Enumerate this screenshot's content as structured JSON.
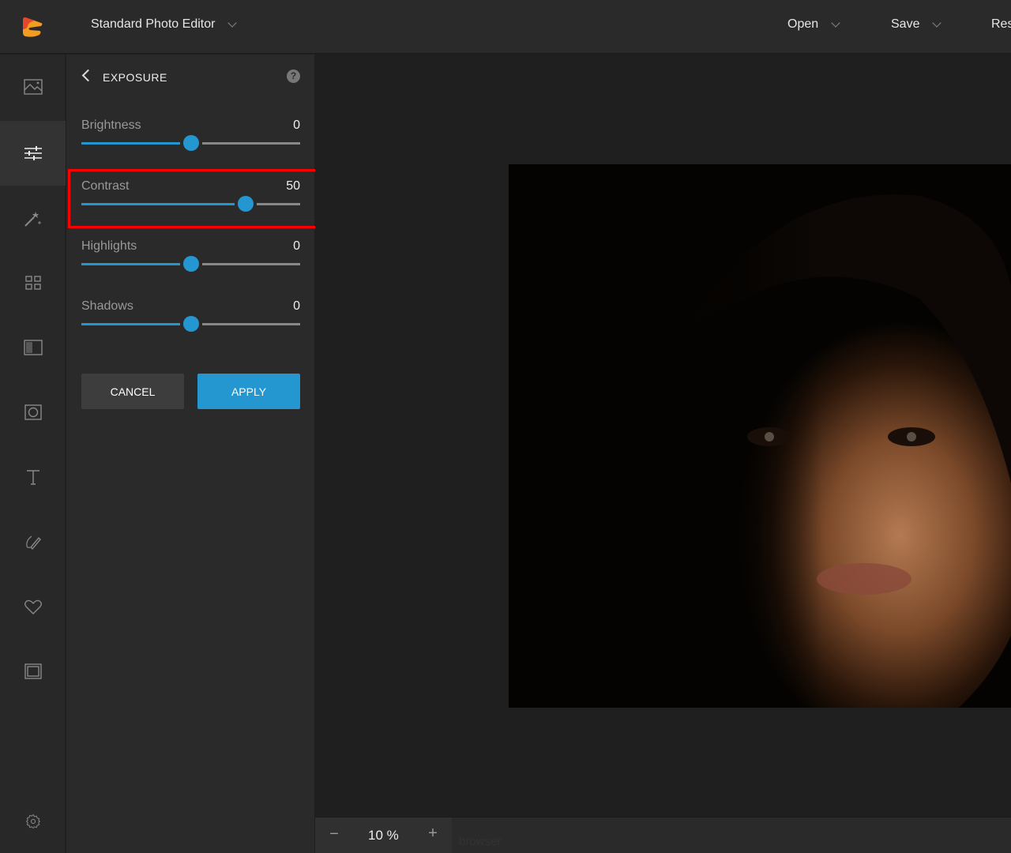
{
  "topbar": {
    "app_title": "Standard Photo Editor",
    "menus": [
      {
        "label": "Open"
      },
      {
        "label": "Save"
      },
      {
        "label": "Res"
      }
    ]
  },
  "rail": {
    "items": [
      {
        "icon": "image-icon",
        "label": "Image"
      },
      {
        "icon": "adjustments-icon",
        "label": "Adjustments",
        "active": true
      },
      {
        "icon": "magic-wand-icon",
        "label": "Effects"
      },
      {
        "icon": "grid-icon",
        "label": "Collage"
      },
      {
        "icon": "texture-icon",
        "label": "Textures"
      },
      {
        "icon": "vignette-icon",
        "label": "Overlays"
      },
      {
        "icon": "text-icon",
        "label": "Text"
      },
      {
        "icon": "draw-icon",
        "label": "Draw"
      },
      {
        "icon": "heart-icon",
        "label": "Stickers"
      },
      {
        "icon": "frame-icon",
        "label": "Frames"
      }
    ],
    "settings_icon": "gear-icon"
  },
  "panel": {
    "title": "EXPOSURE",
    "help": "?",
    "sliders": [
      {
        "label": "Brightness",
        "value": "0",
        "min": -100,
        "max": 100,
        "current": 0
      },
      {
        "label": "Contrast",
        "value": "50",
        "min": -100,
        "max": 100,
        "current": 50
      },
      {
        "label": "Highlights",
        "value": "0",
        "min": -100,
        "max": 100,
        "current": 0
      },
      {
        "label": "Shadows",
        "value": "0",
        "min": -100,
        "max": 100,
        "current": 0
      }
    ],
    "cancel_label": "CANCEL",
    "apply_label": "APPLY"
  },
  "bottombar": {
    "zoom_minus": "−",
    "zoom_value": "10 %",
    "zoom_plus": "+",
    "hint_text": "browser"
  },
  "colors": {
    "accent": "#2496d0",
    "highlight_box": "#ff0000"
  }
}
